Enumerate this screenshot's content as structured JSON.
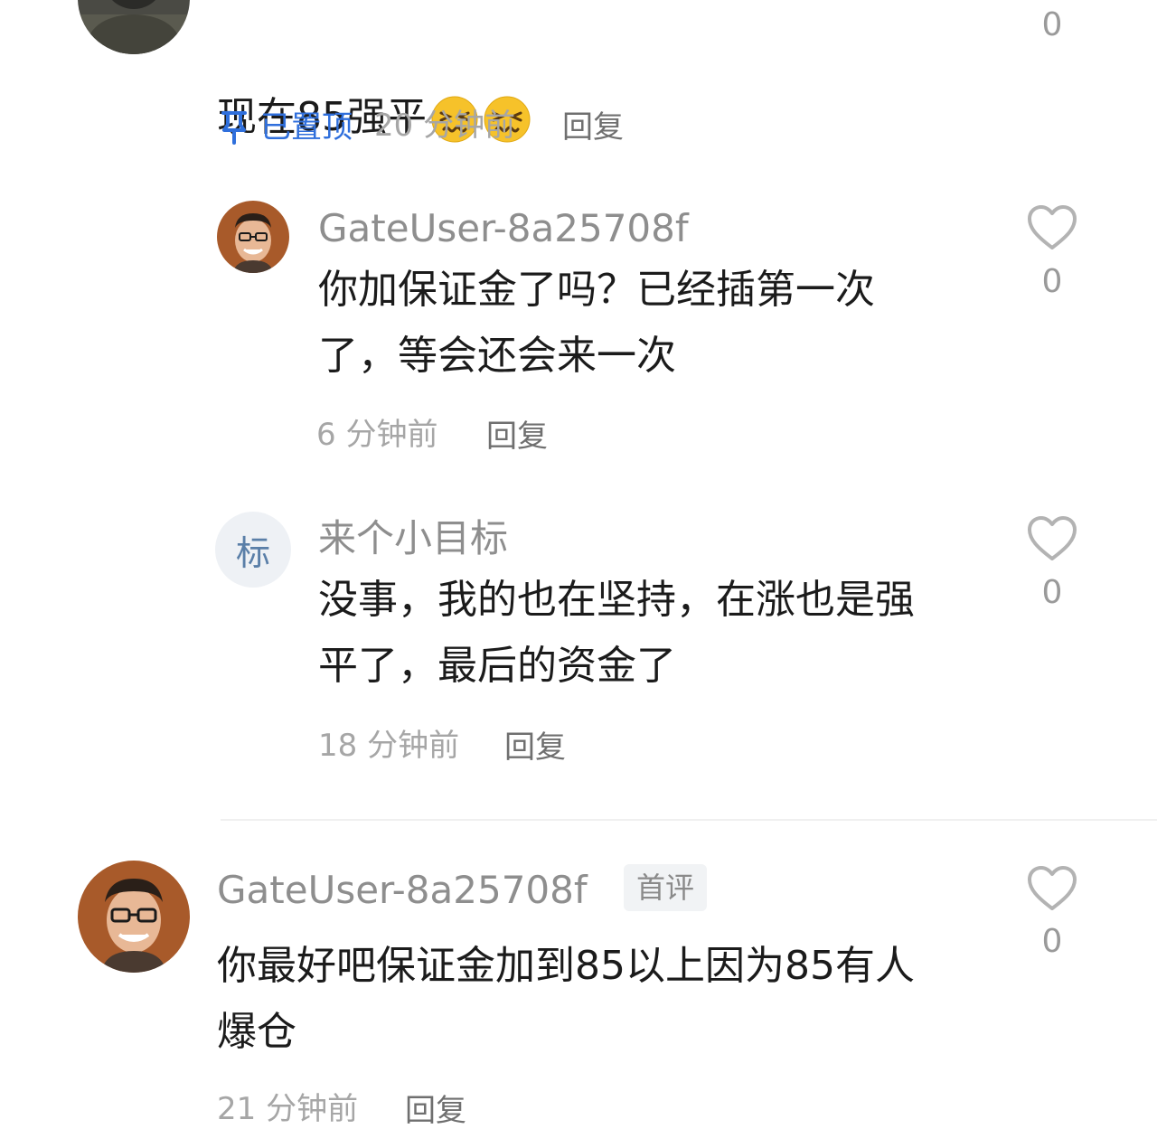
{
  "top_comment": {
    "text": "现在85强平",
    "emojis": [
      "persevering-face-emoji",
      "persevering-face-emoji"
    ],
    "pinned_label": "已置顶",
    "time": "20 分钟前",
    "reply_label": "回复",
    "likes": "0"
  },
  "replies": [
    {
      "username": "GateUser-8a25708f",
      "text": "你加保证金了吗？已经插第一次\n了，等会还会来一次",
      "time": "6 分钟前",
      "reply_label": "回复",
      "likes": "0",
      "avatar": "person-photo-avatar"
    },
    {
      "username": "来个小目标",
      "avatar_char": "标",
      "text": "没事，我的也在坚持，在涨也是强\n平了，最后的资金了",
      "time": "18 分钟前",
      "reply_label": "回复",
      "likes": "0"
    }
  ],
  "second_comment": {
    "username": "GateUser-8a25708f",
    "badge": "首评",
    "text": "你最好吧保证金加到85以上因为85有人\n爆仓",
    "time": "21 分钟前",
    "reply_label": "回复",
    "likes": "0",
    "avatar": "person-photo-avatar"
  },
  "colors": {
    "pinned": "#2f6fdc",
    "username": "#8e8e8e",
    "meta": "#a6a6a6",
    "text": "#1b1b1b"
  },
  "icons": {
    "like": "heart-outline-icon",
    "pin": "pin-icon"
  }
}
